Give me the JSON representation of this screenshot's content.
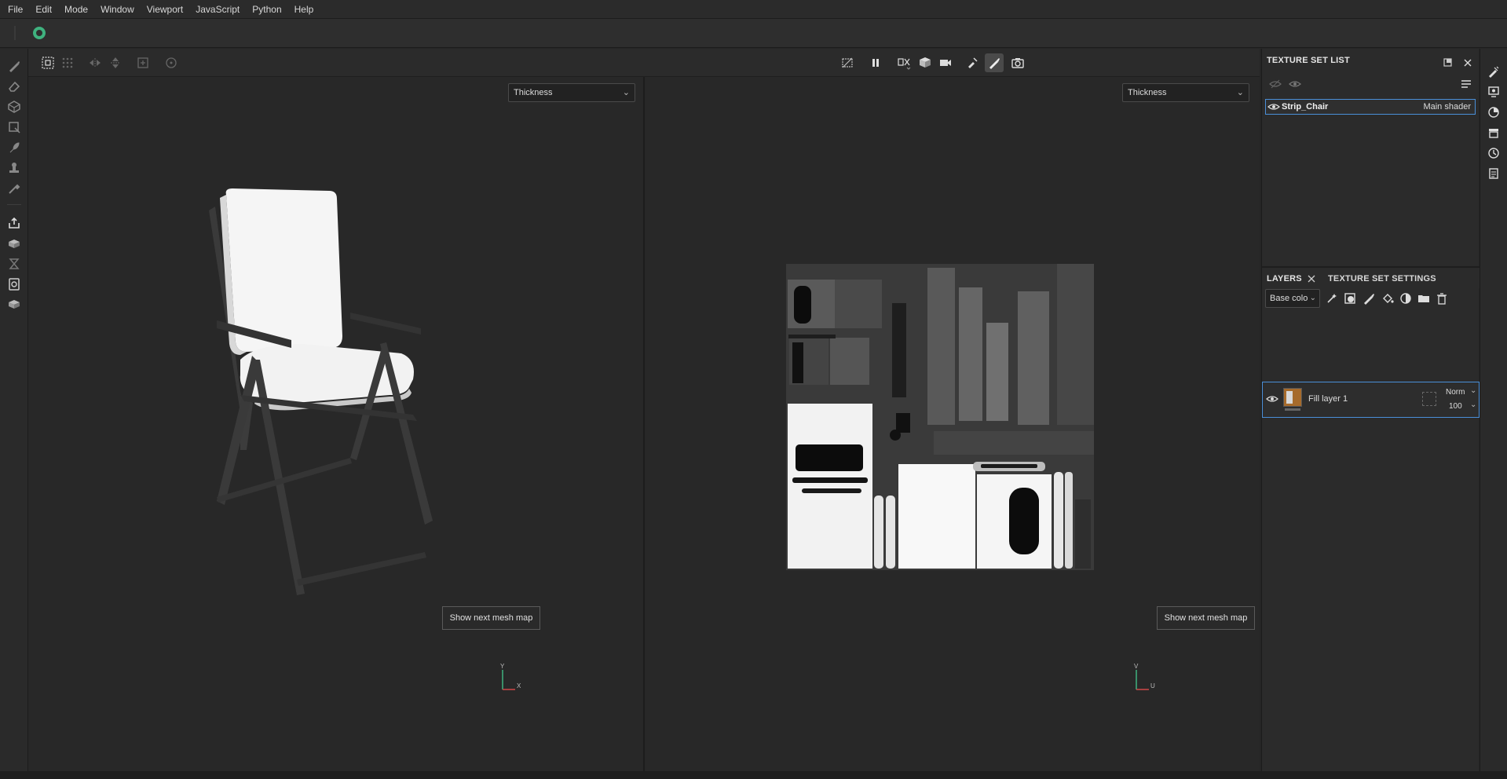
{
  "menu": [
    "File",
    "Edit",
    "Mode",
    "Window",
    "Viewport",
    "JavaScript",
    "Python",
    "Help"
  ],
  "viewport_left": {
    "channel": "Thickness",
    "mesh_button": "Show next mesh map",
    "axis_y": "Y",
    "axis_x": "X"
  },
  "viewport_right": {
    "channel": "Thickness",
    "mesh_button": "Show next mesh map",
    "axis_v": "V",
    "axis_u": "U"
  },
  "texture_set_list": {
    "title": "TEXTURE SET LIST",
    "item": {
      "name": "Strip_Chair",
      "shader": "Main shader"
    }
  },
  "layers_panel": {
    "tab_layers": "LAYERS",
    "tab_settings": "TEXTURE SET SETTINGS",
    "channel_select": "Base colo",
    "layer": {
      "name": "Fill layer 1",
      "blend": "Norm",
      "opacity": "100"
    }
  },
  "colors": {
    "accent": "#4a8fd8",
    "status_green": "#3fb27f"
  }
}
